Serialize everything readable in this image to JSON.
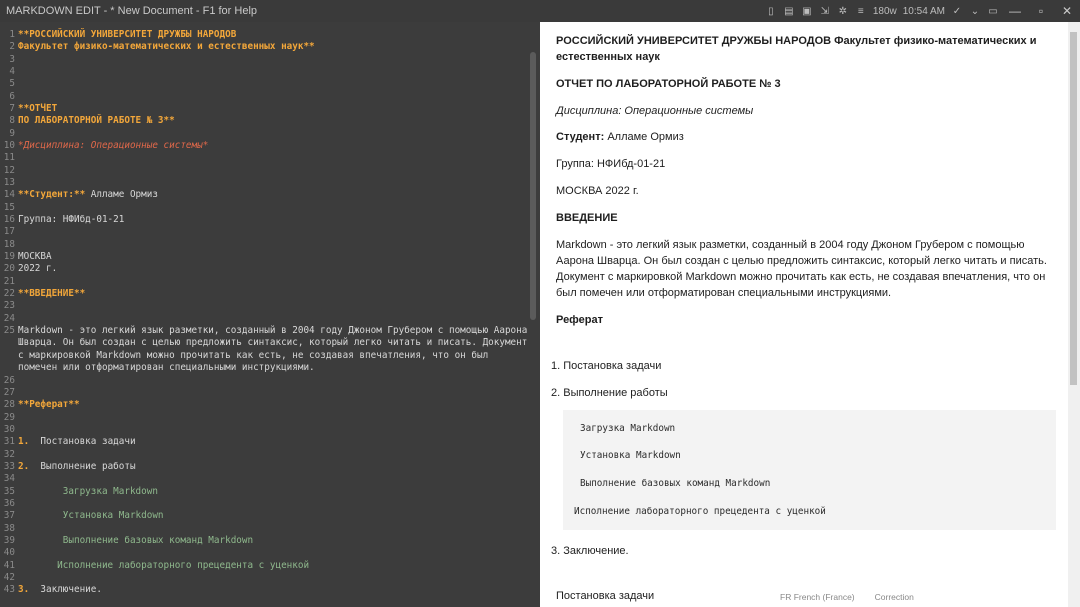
{
  "titlebar": {
    "title": "MARKDOWN EDIT - * New Document - F1 for Help",
    "word_count": "180w",
    "time": "10:54 AM"
  },
  "editor": {
    "lines": [
      {
        "n": "1",
        "t": "**РОССИЙСКИЙ УНИВЕРСИТЕТ ДРУЖБЫ НАРОДОВ",
        "s": "bold"
      },
      {
        "n": "2",
        "t": "Факультет физико-математических и естественных наук**",
        "s": "bold"
      },
      {
        "n": "3",
        "t": "",
        "s": ""
      },
      {
        "n": "4",
        "t": "",
        "s": ""
      },
      {
        "n": "5",
        "t": "",
        "s": ""
      },
      {
        "n": "6",
        "t": "",
        "s": ""
      },
      {
        "n": "7",
        "t": "**ОТЧЕТ",
        "s": "bold"
      },
      {
        "n": "8",
        "t": "ПО ЛАБОРАТОРНОЙ РАБОТЕ № 3**",
        "s": "bold"
      },
      {
        "n": "9",
        "t": "",
        "s": ""
      },
      {
        "n": "10",
        "t": "*Дисциплина: Операционные системы*",
        "s": "italic"
      },
      {
        "n": "11",
        "t": "",
        "s": ""
      },
      {
        "n": "12",
        "t": "",
        "s": ""
      },
      {
        "n": "13",
        "t": "",
        "s": ""
      },
      {
        "n": "14",
        "t": "**Студент:** Алламе Ормиз",
        "s": "student"
      },
      {
        "n": "15",
        "t": "",
        "s": ""
      },
      {
        "n": "16",
        "t": "Группа: НФИбд-01-21",
        "s": ""
      },
      {
        "n": "17",
        "t": "",
        "s": ""
      },
      {
        "n": "18",
        "t": "",
        "s": ""
      },
      {
        "n": "19",
        "t": "МОСКВА",
        "s": ""
      },
      {
        "n": "20",
        "t": "2022 г.",
        "s": ""
      },
      {
        "n": "21",
        "t": "",
        "s": ""
      },
      {
        "n": "22",
        "t": "**ВВЕДЕНИЕ**",
        "s": "bold"
      },
      {
        "n": "23",
        "t": "",
        "s": ""
      },
      {
        "n": "24",
        "t": "",
        "s": ""
      },
      {
        "n": "25",
        "t": "Markdown - это легкий язык разметки, созданный в 2004 году Джоном Грубером с помощью Аарона Шварца. Он был создан с целью предложить синтаксис, который легко читать и писать. Документ с маркировкой Markdown можно прочитать как есть, не создавая впечатления, что он был помечен или отформатирован специальными инструкциями.",
        "s": "wrap"
      },
      {
        "n": "26",
        "t": "",
        "s": ""
      },
      {
        "n": "27",
        "t": "",
        "s": ""
      },
      {
        "n": "28",
        "t": "**Реферат**",
        "s": "bold"
      },
      {
        "n": "29",
        "t": "",
        "s": ""
      },
      {
        "n": "30",
        "t": "",
        "s": ""
      },
      {
        "n": "31",
        "t": "1.  Постановка задачи",
        "s": "num"
      },
      {
        "n": "32",
        "t": "",
        "s": ""
      },
      {
        "n": "33",
        "t": "2.  Выполнение работы",
        "s": "num"
      },
      {
        "n": "34",
        "t": "",
        "s": ""
      },
      {
        "n": "35",
        "t": "        Загрузка Markdown",
        "s": "code"
      },
      {
        "n": "36",
        "t": "",
        "s": ""
      },
      {
        "n": "37",
        "t": "        Установка Markdown",
        "s": "code"
      },
      {
        "n": "38",
        "t": "",
        "s": ""
      },
      {
        "n": "39",
        "t": "        Выполнение базовых команд Markdown",
        "s": "code"
      },
      {
        "n": "40",
        "t": "",
        "s": ""
      },
      {
        "n": "41",
        "t": "       Исполнение лабораторного прецедента с уценкой",
        "s": "code"
      },
      {
        "n": "42",
        "t": "",
        "s": ""
      },
      {
        "n": "43",
        "t": "3.  Заключение.",
        "s": "num"
      }
    ]
  },
  "preview": {
    "header": "РОССИЙСКИЙ УНИВЕРСИТЕТ ДРУЖБЫ НАРОДОВ Факультет физико-математических и естественных наук",
    "report_title": "ОТЧЕТ ПО ЛАБОРАТОРНОЙ РАБОТЕ № 3",
    "discipline": "Дисциплина: Операционные системы",
    "student_label": "Студент:",
    "student_name": "Алламе Ормиз",
    "group": "Группа: НФИбд-01-21",
    "city_year": "МОСКВА 2022 г.",
    "intro_heading": "ВВЕДЕНИЕ",
    "intro_text": "Markdown - это легкий язык разметки, созданный в 2004 году Джоном Грубером с помощью Аарона Шварца. Он был создан с целью предложить синтаксис, который легко читать и писать. Документ с маркировкой Markdown можно прочитать как есть, не создавая впечатления, что он был помечен или отформатирован специальными инструкциями.",
    "abstract_heading": "Реферат",
    "list": [
      "1. Постановка задачи",
      "2. Выполнение работы",
      "3. Заключение."
    ],
    "code_lines": [
      "Загрузка Markdown",
      "Установка Markdown",
      "Выполнение базовых команд Markdown",
      "Исполнение лабораторного прецедента с уценкой"
    ],
    "bottom_item": "Постановка задачи"
  },
  "status": {
    "language": "FR French (France)",
    "correction": "Correction"
  }
}
